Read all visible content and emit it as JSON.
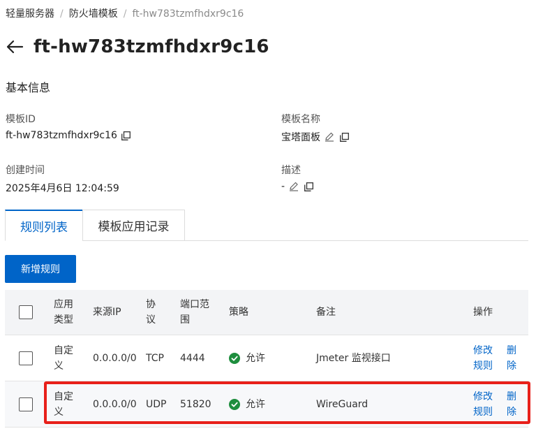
{
  "breadcrumb": [
    "轻量服务器",
    "防火墙模板",
    "ft-hw783tzmfhdxr9c16"
  ],
  "page_title": "ft-hw783tzmfhdxr9c16",
  "section_title": "基本信息",
  "info": {
    "template_id_label": "模板ID",
    "template_id_value": "ft-hw783tzmfhdxr9c16",
    "template_name_label": "模板名称",
    "template_name_value": "宝塔面板",
    "created_label": "创建时间",
    "created_value": "2025年4月6日 12:04:59",
    "desc_label": "描述",
    "desc_value": "-"
  },
  "tabs": [
    "规则列表",
    "模板应用记录"
  ],
  "add_rule_button": "新增规则",
  "table": {
    "headers": [
      "应用类型",
      "来源IP",
      "协议",
      "端口范围",
      "策略",
      "备注",
      "操作"
    ],
    "rows": [
      {
        "app_type": "自定义",
        "source_ip": "0.0.0.0/0",
        "protocol": "TCP",
        "port": "4444",
        "policy": "允许",
        "note": "Jmeter 监视接口",
        "edit": "修改规则",
        "delete": "删除"
      },
      {
        "app_type": "自定义",
        "source_ip": "0.0.0.0/0",
        "protocol": "UDP",
        "port": "51820",
        "policy": "允许",
        "note": "WireGuard",
        "edit": "修改规则",
        "delete": "删除"
      }
    ]
  },
  "colors": {
    "accent": "#0064c8",
    "success": "#1e8e3e",
    "highlight_border": "#e8201a"
  }
}
